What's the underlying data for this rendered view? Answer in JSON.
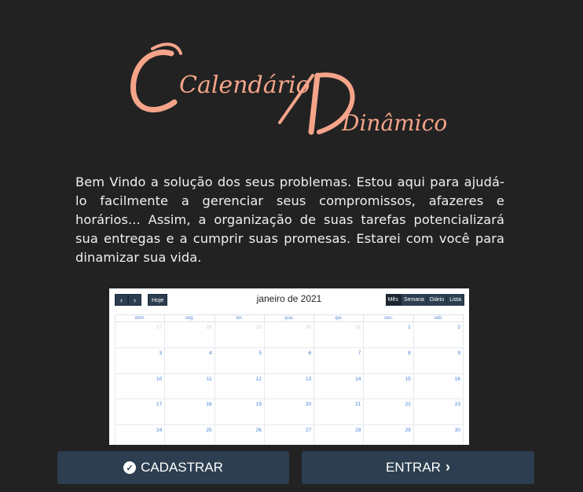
{
  "logo": {
    "word1": "Calendário",
    "word2": "Dinâmico",
    "color": "#f5a48a"
  },
  "intro_text": "Bem Vindo a solução dos seus problemas. Estou aqui para ajudá-lo facilmente a gerenciar seus compromissos, afazeres e horários... Assim, a organização de suas tarefas potencializará sua entregas e a cumprir suas promesas. Estarei com você para dinamizar sua vida.",
  "calendar": {
    "title": "janeiro de 2021",
    "prev_icon": "chevron-left-icon",
    "next_icon": "chevron-right-icon",
    "today_label": "Hoje",
    "views": [
      "Mês",
      "Semana",
      "Diário",
      "Lista"
    ],
    "active_view": "Mês",
    "weekdays": [
      "dom.",
      "seg.",
      "ter.",
      "qua.",
      "qui.",
      "sex.",
      "sáb."
    ],
    "weeks": [
      [
        {
          "d": "27",
          "o": true
        },
        {
          "d": "28",
          "o": true
        },
        {
          "d": "29",
          "o": true
        },
        {
          "d": "30",
          "o": true
        },
        {
          "d": "31",
          "o": true
        },
        {
          "d": "1"
        },
        {
          "d": "2"
        }
      ],
      [
        {
          "d": "3"
        },
        {
          "d": "4"
        },
        {
          "d": "5"
        },
        {
          "d": "6"
        },
        {
          "d": "7"
        },
        {
          "d": "8"
        },
        {
          "d": "9"
        }
      ],
      [
        {
          "d": "10"
        },
        {
          "d": "11"
        },
        {
          "d": "12"
        },
        {
          "d": "13"
        },
        {
          "d": "14"
        },
        {
          "d": "15"
        },
        {
          "d": "16"
        }
      ],
      [
        {
          "d": "17"
        },
        {
          "d": "18"
        },
        {
          "d": "19"
        },
        {
          "d": "20"
        },
        {
          "d": "21"
        },
        {
          "d": "22"
        },
        {
          "d": "23"
        }
      ],
      [
        {
          "d": "24"
        },
        {
          "d": "25"
        },
        {
          "d": "26"
        },
        {
          "d": "27"
        },
        {
          "d": "28"
        },
        {
          "d": "29"
        },
        {
          "d": "30"
        }
      ]
    ]
  },
  "buttons": {
    "register_label": "CADASTRAR",
    "register_icon": "check-circle-icon",
    "enter_label": "ENTRAR",
    "enter_icon": "chevron-right-icon"
  },
  "colors": {
    "background": "#222222",
    "button": "#2c3e50",
    "accent": "#f5a48a"
  }
}
